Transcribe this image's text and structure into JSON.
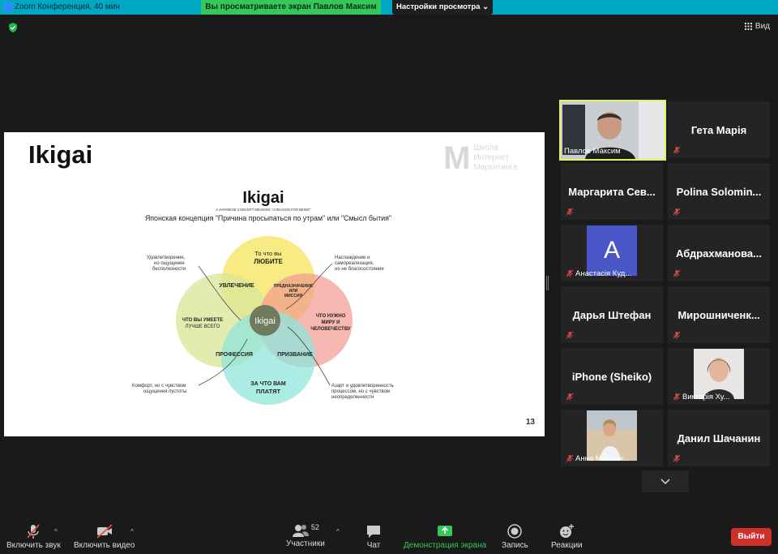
{
  "window": {
    "title": "Zoom Конференция, 40 мин"
  },
  "banner": {
    "share_text": "Вы просматриваете экран Павлов Максим",
    "view_options": "Настройки просмотра"
  },
  "top_right": {
    "view_label": "Вид"
  },
  "slide": {
    "title": "Ikigai",
    "logo_lines": [
      "Школа",
      "Интернет",
      "Маркетинга"
    ],
    "page_number": "13",
    "diagram": {
      "title": "Ikigai",
      "subtitle": "A JAPANESE CONCEPT MEANING \"A REASON FOR BEING\"",
      "caption": "Японская концепция \"Причина просыпаться по утрам\" или \"Смысл бытия\"",
      "center": "Ikigai",
      "top_circle": [
        "То что вы",
        "ЛЮБИТЕ"
      ],
      "left_circle": [
        "ЧТО ВЫ УМЕЕТЕ",
        "ЛУЧШЕ ВСЕГО"
      ],
      "right_circle": [
        "ЧТО НУЖНО",
        "МИРУ И",
        "ЧЕЛОВЕЧЕСТВУ"
      ],
      "bottom_circle": [
        "ЗА ЧТО ВАМ",
        "ПЛАТЯТ"
      ],
      "overlap_top_left": "УВЛЕЧЕНИЕ",
      "overlap_top_right": [
        "ПРЕДНАЗНАЧЕНИЕ",
        "ИЛИ",
        "МИССИЯ"
      ],
      "overlap_bottom_left": "ПРОФЕССИЯ",
      "overlap_bottom_right": "ПРИЗВАНИЕ",
      "note_top_left": [
        "Удовлетворение,",
        "но ощущение",
        "бесполезности"
      ],
      "note_top_right": [
        "Наслаждение и",
        "самореализация,",
        "но не благосостояние"
      ],
      "note_bottom_left": [
        "Комфорт, но с чувством",
        "ощущения пустоты"
      ],
      "note_bottom_right": [
        "Азарт и удовлетворенность",
        "процессом, но с чувством",
        "неопределенности"
      ]
    }
  },
  "participants": [
    {
      "name": "Павлов Максим",
      "type": "video"
    },
    {
      "name": "Гета Марія",
      "type": "name"
    },
    {
      "name": "Маргарита Сев...",
      "type": "name"
    },
    {
      "name": "Polina Solomin...",
      "type": "name"
    },
    {
      "name": "Анастасія Куд...",
      "type": "avatar",
      "initial": "A"
    },
    {
      "name": "Абдрахманова...",
      "type": "name"
    },
    {
      "name": "Дарья Штефан",
      "type": "name"
    },
    {
      "name": "Мирошниченк...",
      "type": "name"
    },
    {
      "name": "iPhone (Sheiko)",
      "type": "name"
    },
    {
      "name": "Викторія Ху...",
      "type": "photo"
    },
    {
      "name": "Анна Маслен...",
      "type": "photo"
    },
    {
      "name": "Данил Шачанин",
      "type": "name"
    }
  ],
  "toolbar": {
    "mute": "Включить звук",
    "video": "Включить видео",
    "participants": "Участники",
    "participants_count": "52",
    "chat": "Чат",
    "share": "Демонстрация экрана",
    "record": "Запись",
    "reactions": "Реакции",
    "leave": "Выйти"
  }
}
